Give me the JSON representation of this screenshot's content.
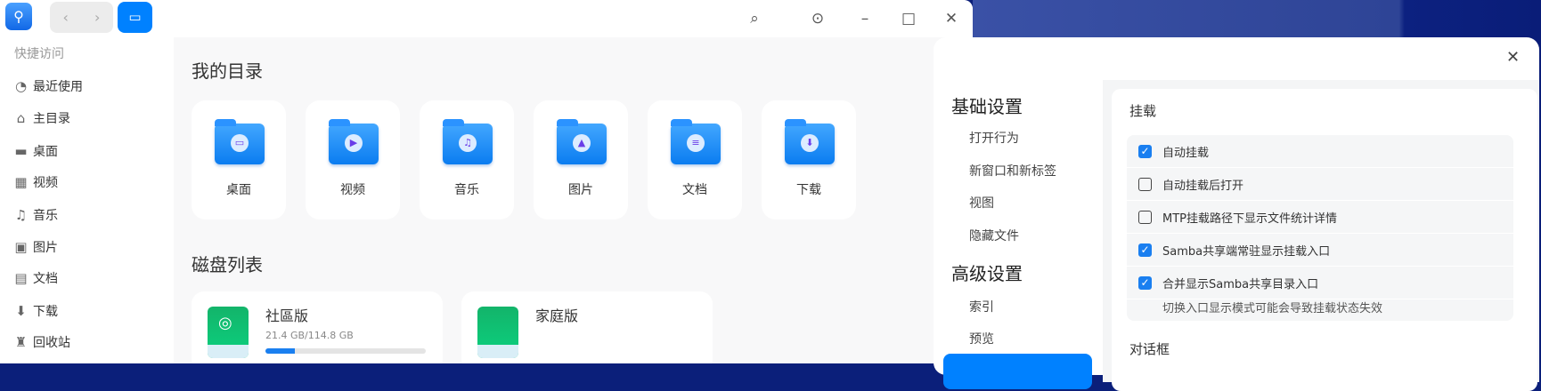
{
  "file_manager": {
    "nav": {
      "back": "‹",
      "forward": "›"
    },
    "sidebar": {
      "title": "快捷访问",
      "items": [
        {
          "label": "最近使用",
          "icon": "clock-icon",
          "glyph": "◔"
        },
        {
          "label": "主目录",
          "icon": "home-icon",
          "glyph": "⌂"
        },
        {
          "label": "桌面",
          "icon": "desktop-icon",
          "glyph": "▬"
        },
        {
          "label": "视频",
          "icon": "video-icon",
          "glyph": "▦"
        },
        {
          "label": "音乐",
          "icon": "music-icon",
          "glyph": "♫"
        },
        {
          "label": "图片",
          "icon": "picture-icon",
          "glyph": "▣"
        },
        {
          "label": "文档",
          "icon": "document-icon",
          "glyph": "▤"
        },
        {
          "label": "下载",
          "icon": "download-icon",
          "glyph": "⬇"
        },
        {
          "label": "回收站",
          "icon": "trash-icon",
          "glyph": "♜"
        }
      ]
    },
    "my_dirs": {
      "title": "我的目录",
      "items": [
        {
          "label": "桌面",
          "glyph": "▭"
        },
        {
          "label": "视频",
          "glyph": "▶"
        },
        {
          "label": "音乐",
          "glyph": "♫"
        },
        {
          "label": "图片",
          "glyph": "▲"
        },
        {
          "label": "文档",
          "glyph": "≡"
        },
        {
          "label": "下载",
          "glyph": "⬇"
        }
      ]
    },
    "disks": {
      "title": "磁盘列表",
      "items": [
        {
          "name": "社區版",
          "size": "21.4 GB/114.8 GB",
          "used_fraction": 0.186
        },
        {
          "name": "家庭版"
        }
      ]
    }
  },
  "settings": {
    "close": "✕",
    "nav": {
      "basic": "基础设置",
      "basic_items": [
        "打开行为",
        "新窗口和新标签",
        "视图",
        "隐藏文件"
      ],
      "advanced": "高级设置",
      "advanced_items": [
        "索引",
        "预览"
      ]
    },
    "mount": {
      "title": "挂载",
      "options": [
        {
          "label": "自动挂载",
          "checked": true
        },
        {
          "label": "自动挂载后打开",
          "checked": false
        },
        {
          "label": "MTP挂载路径下显示文件统计详情",
          "checked": false
        },
        {
          "label": "Samba共享端常驻显示挂载入口",
          "checked": true
        },
        {
          "label": "合并显示Samba共享目录入口",
          "checked": true
        }
      ],
      "note": "切换入口显示模式可能会导致挂载状态失效"
    },
    "dialog_section": "对话框"
  }
}
